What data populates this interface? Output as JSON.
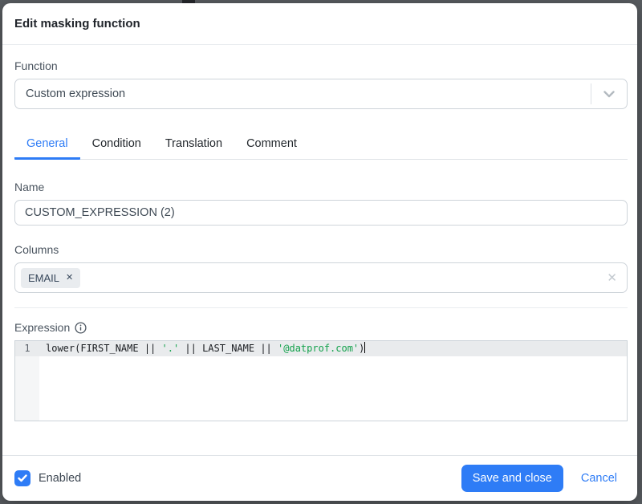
{
  "dialog": {
    "title": "Edit masking function"
  },
  "function_section": {
    "label": "Function",
    "selected_value": "Custom expression"
  },
  "tabs": {
    "items": [
      {
        "label": "General",
        "active": true
      },
      {
        "label": "Condition",
        "active": false
      },
      {
        "label": "Translation",
        "active": false
      },
      {
        "label": "Comment",
        "active": false
      }
    ]
  },
  "name_section": {
    "label": "Name",
    "value": "CUSTOM_EXPRESSION (2)"
  },
  "columns_section": {
    "label": "Columns",
    "tags": [
      {
        "label": "EMAIL"
      }
    ],
    "tag_remove_glyph": "✕",
    "clear_glyph": "✕"
  },
  "expression_section": {
    "label": "Expression",
    "line_number": "1",
    "code_segments": [
      {
        "text": "lower(FIRST_NAME || ",
        "type": "plain"
      },
      {
        "text": "'.'",
        "type": "string"
      },
      {
        "text": " || LAST_NAME || ",
        "type": "plain"
      },
      {
        "text": "'@datprof.com'",
        "type": "string"
      },
      {
        "text": ")",
        "type": "plain"
      }
    ]
  },
  "footer": {
    "enabled_label": "Enabled",
    "enabled_checked": true,
    "save_label": "Save and close",
    "cancel_label": "Cancel"
  },
  "colors": {
    "accent_blue": "#2e7cf6",
    "string_green": "#12a14b",
    "tag_background": "#e9ecef",
    "backdrop": "#585c60"
  }
}
